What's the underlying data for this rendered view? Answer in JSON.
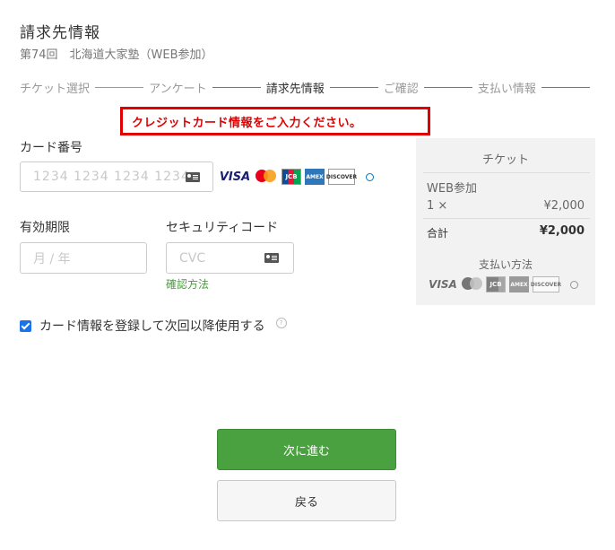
{
  "header": {
    "title": "請求先情報",
    "event": "第74回　北海道大家塾（WEB参加）"
  },
  "steps": [
    {
      "label": "チケット選択"
    },
    {
      "label": "アンケート"
    },
    {
      "label": "請求先情報"
    },
    {
      "label": "ご確認"
    },
    {
      "label": "支払い情報"
    }
  ],
  "error": {
    "message": "クレジットカード情報をご入力ください。"
  },
  "form": {
    "card_label": "カード番号",
    "card_placeholder": "1234  1234  1234  1234",
    "expiry_label": "有効期限",
    "expiry_placeholder": "月  /  年",
    "cvc_label": "セキュリティコード",
    "cvc_placeholder": "CVC",
    "confirm_link": "確認方法",
    "save_card": "カード情報を登録して次回以降使用する",
    "help": "?"
  },
  "brands": {
    "visa": "VISA",
    "jcb": "JCB",
    "amex": "AMEX",
    "discover": "DISCOVER",
    "diners": "Diners Club"
  },
  "summary": {
    "heading": "チケット",
    "item": "WEB参加",
    "qty": "1 ×",
    "price": "¥2,000",
    "total_label": "合計",
    "total_value": "¥2,000",
    "payment_label": "支払い方法"
  },
  "buttons": {
    "next": "次に進む",
    "back": "戻る"
  },
  "colors": {
    "accent": "#4aa13f",
    "error": "#e00000"
  }
}
